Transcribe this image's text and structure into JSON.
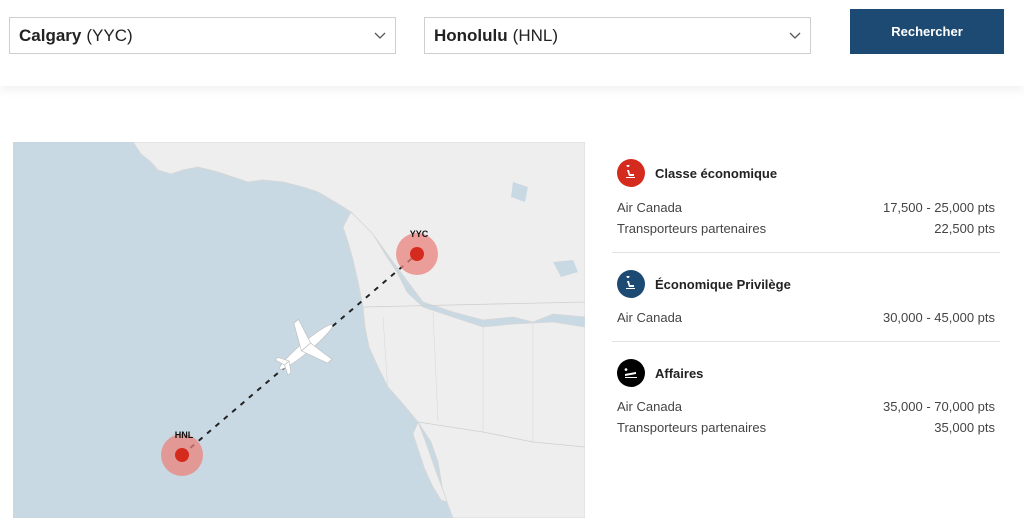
{
  "search": {
    "origin": {
      "city": "Calgary",
      "code": "(YYC)"
    },
    "destination": {
      "city": "Honolulu",
      "code": "(HNL)"
    },
    "button_label": "Rechercher"
  },
  "map": {
    "origin_label": "YYC",
    "destination_label": "HNL"
  },
  "fares": [
    {
      "title": "Classe économique",
      "badge_color": "#d52b1e",
      "icon": "economy-seat-icon",
      "rows": [
        {
          "carrier": "Air Canada",
          "points": "17,500 - 25,000 pts"
        },
        {
          "carrier": "Transporteurs partenaires",
          "points": "22,500 pts"
        }
      ]
    },
    {
      "title": "Économique Privilège",
      "badge_color": "#1d4a72",
      "icon": "premium-seat-icon",
      "rows": [
        {
          "carrier": "Air Canada",
          "points": "30,000 - 45,000 pts"
        }
      ]
    },
    {
      "title": "Affaires",
      "badge_color": "#000000",
      "icon": "lie-flat-seat-icon",
      "rows": [
        {
          "carrier": "Air Canada",
          "points": "35,000 - 70,000 pts"
        },
        {
          "carrier": "Transporteurs partenaires",
          "points": "35,000 pts"
        }
      ]
    }
  ]
}
